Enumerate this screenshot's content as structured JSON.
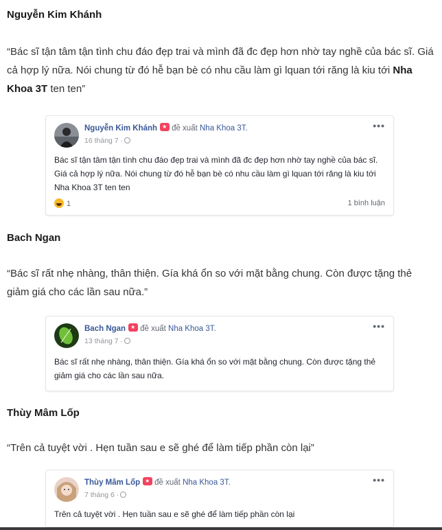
{
  "reviews": [
    {
      "name": "Nguyễn Kim Khánh",
      "quote_before": "“Bác sĩ tận tâm tận tình chu đáo đẹp trai và mình đã đc đẹp hơn nhờ tay nghề của bác sĩ. Giá cả hợp lý nữa. Nói chung từ đó hễ bạn bè có nhu cầu làm gì lquan tới răng là kiu tới ",
      "quote_bold": "Nha Khoa 3T",
      "quote_after": " ten ten”",
      "card": {
        "name": "Nguyễn Kim Khánh",
        "recommends": "đề xuất",
        "page": "Nha Khoa 3T.",
        "date": "16 tháng 7 ·",
        "text": "Bác sĩ tận tâm tận tình chu đáo đẹp trai và mình đã đc đẹp hơn nhờ tay nghề của bác sĩ. Giá cả hợp lý nữa. Nói chung từ đó hễ bạn bè có nhu cầu làm gì lquan tới răng là kiu tới Nha Khoa 3T ten ten",
        "reaction_count": "1",
        "comments": "1 bình luận",
        "more": "•••"
      }
    },
    {
      "name": "Bach Ngan",
      "quote": "“Bác sĩ rất nhẹ nhàng, thân thiện. Gía khá ổn so với mặt bằng chung. Còn được tặng thẻ giảm giá cho các lần sau nữa.”",
      "card": {
        "name": "Bach Ngan",
        "recommends": "đề xuất",
        "page": "Nha Khoa 3T.",
        "date": "13 tháng 7 ·",
        "text": "Bác sĩ rất nhẹ nhàng, thân thiện. Gía khá ổn so với mặt bằng chung. Còn được tặng thẻ giảm giá cho các lần sau nữa.",
        "more": "•••"
      }
    },
    {
      "name": "Thùy Mâm Lốp",
      "quote": "“Trên cả tuyệt vời . Hẹn tuần sau e sẽ ghé để làm tiếp phần còn lại”",
      "card": {
        "name": "Thùy Mâm Lốp",
        "recommends": "đề xuất",
        "page": "Nha Khoa 3T.",
        "date": "7 tháng 6 ·",
        "text": "Trên cả tuyệt vời . Hẹn tuần sau e sẽ ghé để làm tiếp phần còn lại",
        "more": "•••"
      }
    }
  ],
  "colors": {
    "fb_blue": "#385898",
    "badge_red": "#f3425f",
    "meta_gray": "#90949c"
  }
}
